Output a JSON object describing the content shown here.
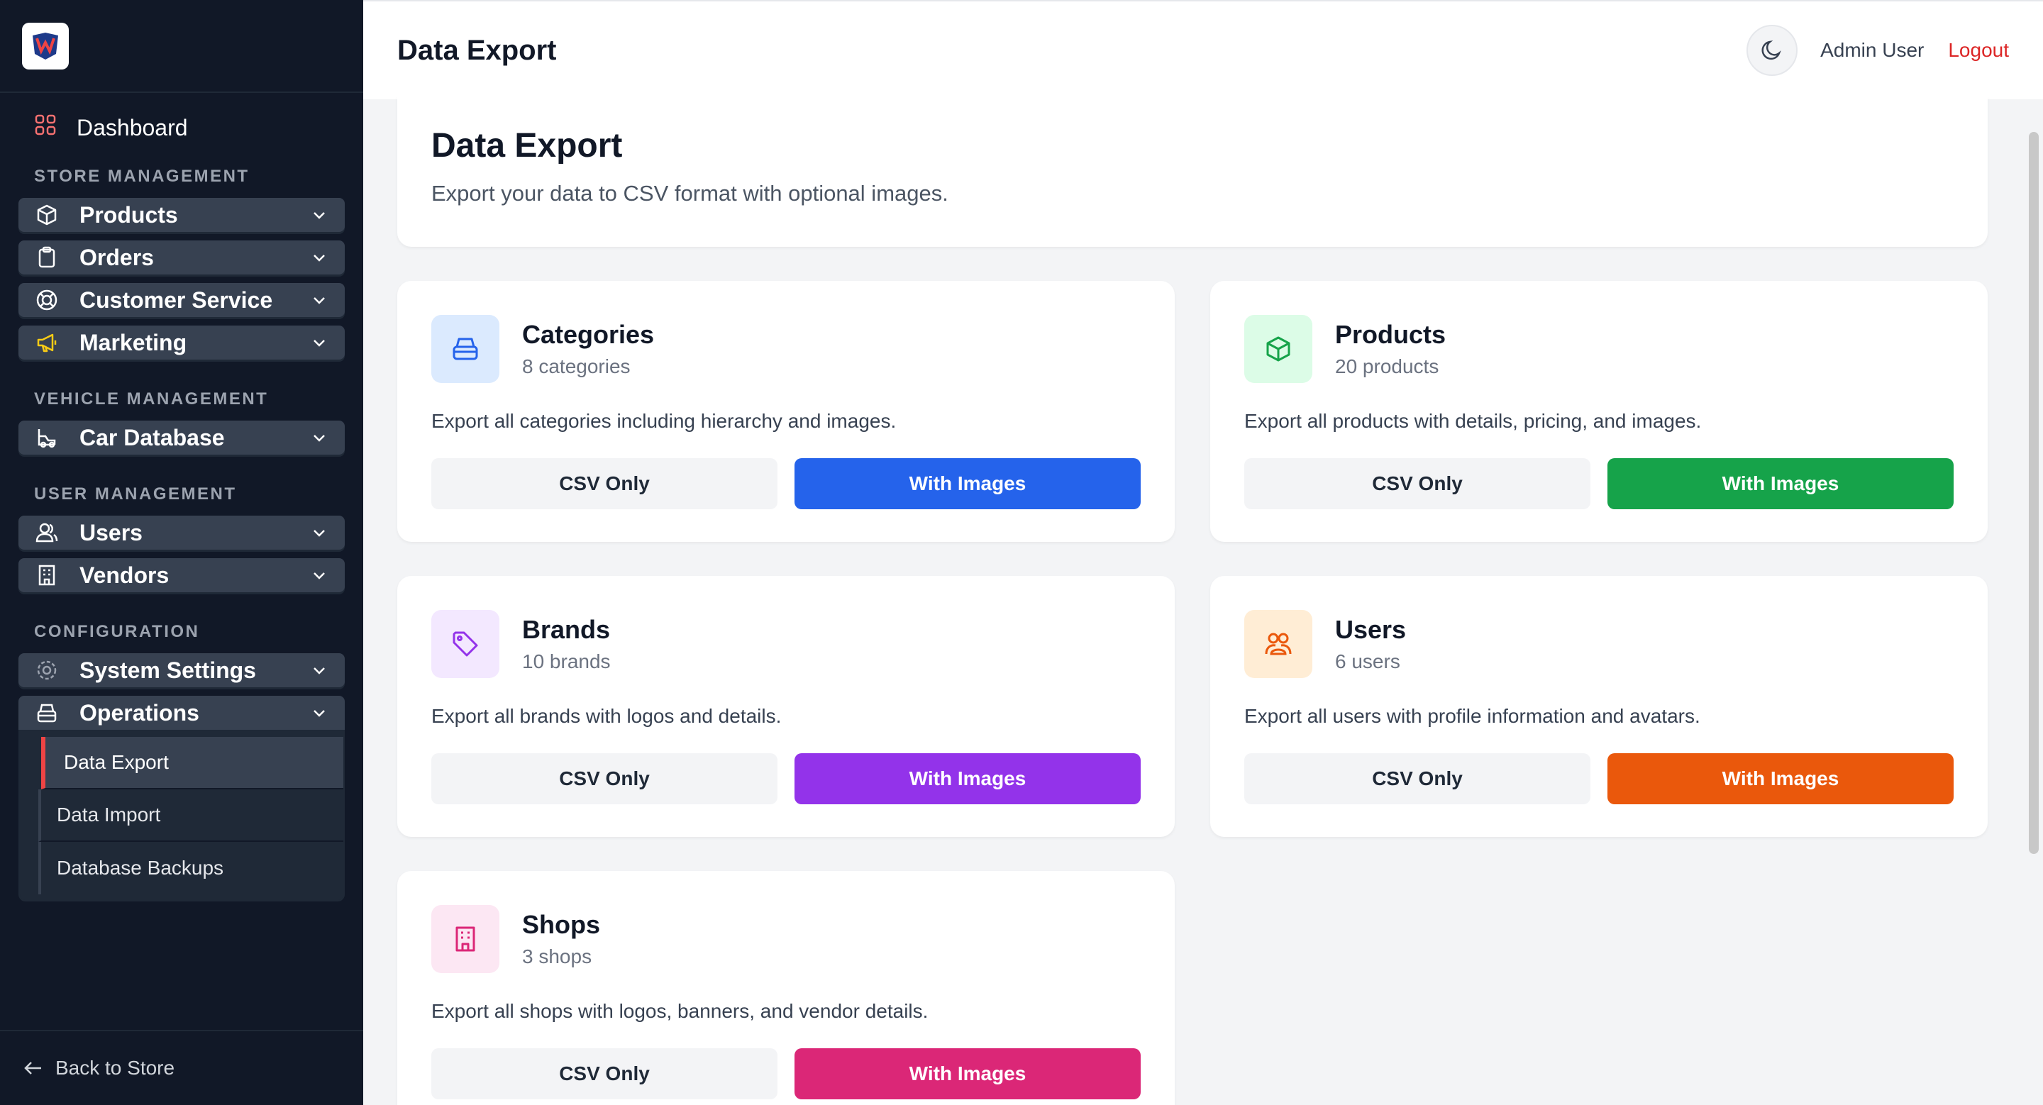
{
  "header": {
    "title": "Data Export",
    "user": "Admin User",
    "logout": "Logout"
  },
  "sidebar": {
    "dashboard": "Dashboard",
    "sections": {
      "store": "STORE MANAGEMENT",
      "vehicle": "VEHICLE MANAGEMENT",
      "user": "USER MANAGEMENT",
      "config": "CONFIGURATION"
    },
    "items": {
      "products": "Products",
      "orders": "Orders",
      "customer_service": "Customer Service",
      "marketing": "Marketing",
      "car_database": "Car Database",
      "users": "Users",
      "vendors": "Vendors",
      "system_settings": "System Settings",
      "operations": "Operations"
    },
    "submenu": {
      "data_export": "Data Export",
      "data_import": "Data Import",
      "database_backups": "Database Backups"
    },
    "back": "Back to Store"
  },
  "intro": {
    "title": "Data Export",
    "subtitle": "Export your data to CSV format with optional images."
  },
  "cards": {
    "categories": {
      "title": "Categories",
      "count": "8 categories",
      "desc": "Export all categories including hierarchy and images.",
      "csv": "CSV Only",
      "images": "With Images",
      "color": "#2563eb"
    },
    "products": {
      "title": "Products",
      "count": "20 products",
      "desc": "Export all products with details, pricing, and images.",
      "csv": "CSV Only",
      "images": "With Images",
      "color": "#16a34a"
    },
    "brands": {
      "title": "Brands",
      "count": "10 brands",
      "desc": "Export all brands with logos and details.",
      "csv": "CSV Only",
      "images": "With Images",
      "color": "#9333ea"
    },
    "users": {
      "title": "Users",
      "count": "6 users",
      "desc": "Export all users with profile information and avatars.",
      "csv": "CSV Only",
      "images": "With Images",
      "color": "#ea580c"
    },
    "shops": {
      "title": "Shops",
      "count": "3 shops",
      "desc": "Export all shops with logos, banners, and vendor details.",
      "csv": "CSV Only",
      "images": "With Images",
      "color": "#db2777"
    }
  }
}
